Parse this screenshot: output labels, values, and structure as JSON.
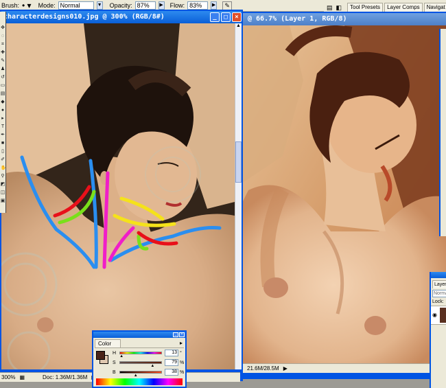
{
  "options_bar": {
    "brush_label": "Brush:",
    "mode_label": "Mode:",
    "mode_value": "Normal",
    "opacity_label": "Opacity:",
    "opacity_value": "87%",
    "flow_label": "Flow:",
    "flow_value": "83%"
  },
  "palette_well": {
    "tabs": [
      "Tool Presets",
      "Layer Comps",
      "Navigat"
    ]
  },
  "doc1": {
    "title": "characterdesigns010.jpg @ 300% (RGB/8#)",
    "zoom": "300%",
    "doc_size": "Doc: 1.36M/1.36M"
  },
  "doc2": {
    "title": "@ 66.7% (Layer 1, RGB/8)",
    "doc_size": "21.6M/28.5M"
  },
  "color_panel": {
    "tab": "Color",
    "h_label": "H",
    "h_value": "13",
    "h_unit": "°",
    "h_fraction": 0.036,
    "s_label": "S",
    "s_value": "79",
    "s_unit": "%",
    "s_fraction": 0.79,
    "b_label": "B",
    "b_value": "38",
    "b_unit": "%",
    "b_fraction": 0.38,
    "colors": {
      "foreground": "#4a2418",
      "background": "#e0c8b0"
    }
  },
  "layers_panel": {
    "tab": "Layer",
    "blend": "Normal",
    "lock": "Lock:"
  },
  "colors": {
    "xp_blue": "#0054e3",
    "stroke_blue": "#2a8ef0",
    "stroke_red": "#e8101a",
    "stroke_green": "#7ae01a",
    "stroke_yellow": "#f5e21a",
    "stroke_magenta": "#f01ec8"
  }
}
